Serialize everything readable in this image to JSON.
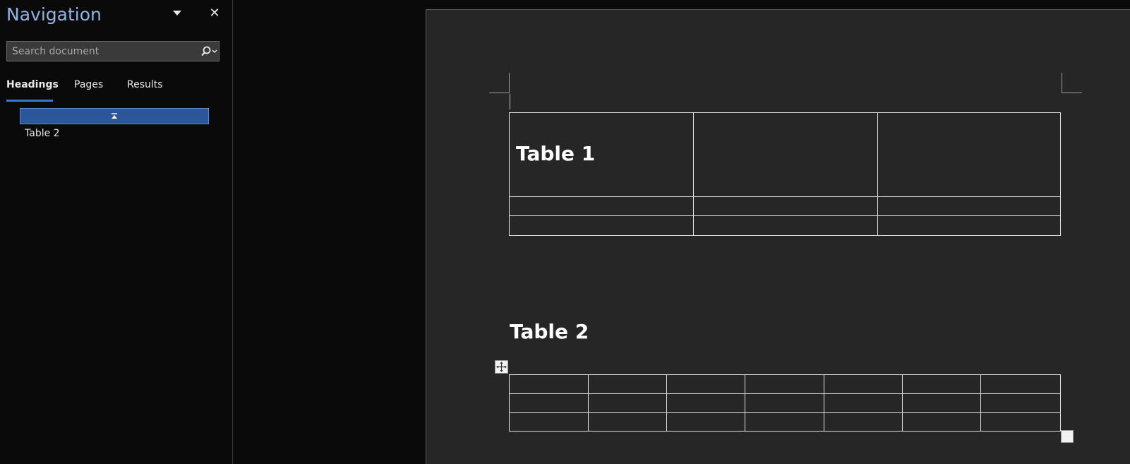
{
  "navigation": {
    "title": "Navigation",
    "search_placeholder": "Search document",
    "tabs": [
      {
        "label": "Headings",
        "active": true
      },
      {
        "label": "Pages",
        "active": false
      },
      {
        "label": "Results",
        "active": false
      }
    ],
    "headings": [
      {
        "label": "",
        "selected": true
      },
      {
        "label": "Table 2",
        "selected": false
      }
    ]
  },
  "document": {
    "table1": {
      "heading": "Table 1",
      "rows": 3,
      "cols": 3
    },
    "table2": {
      "heading": "Table 2",
      "rows": 3,
      "cols": 7
    }
  },
  "colors": {
    "accent": "#3a78d6",
    "selected_heading_bg": "#2b579a",
    "nav_title": "#8fb3e6",
    "page_bg": "#262626",
    "app_bg": "#0a0a0a"
  },
  "icons": [
    "dropdown-arrow-icon",
    "close-icon",
    "search-icon",
    "chevron-down-icon",
    "collapse-icon",
    "move-table-icon",
    "resize-table-icon"
  ]
}
